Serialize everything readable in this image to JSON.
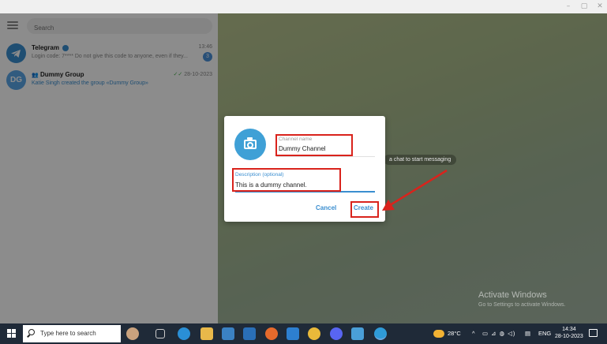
{
  "window": {
    "minimize_glyph": "–",
    "maximize_glyph": "▢",
    "close_glyph": "✕"
  },
  "sidebar": {
    "search_placeholder": "Search",
    "chats": [
      {
        "name": "Telegram",
        "verified": true,
        "time": "13:46",
        "preview": "Login code: 7**** Do not give this code to anyone, even if they...",
        "unread": "3",
        "avatar_color": "#3a8ed0"
      },
      {
        "name": "Dummy Group",
        "avatar_initials": "DG",
        "time": "28-10-2023",
        "preview": "Katie Singh created the group «Dummy Group»",
        "avatar_color": "#5aa6e8",
        "read_icon": "double-check-icon"
      }
    ]
  },
  "chat_area": {
    "hint": "a chat to start messaging"
  },
  "dialog": {
    "name_label": "Channel name",
    "name_value": "Dummy Channel",
    "description_label": "Description (optional)",
    "description_value": "This is a dummy channel.",
    "cancel_label": "Cancel",
    "create_label": "Create",
    "photo_icon": "camera-icon",
    "accent_color": "#3a8ed0"
  },
  "watermark": {
    "title": "Activate Windows",
    "subtitle": "Go to Settings to activate Windows."
  },
  "taskbar": {
    "search_text": "Type here to search",
    "weather": "28°C",
    "language": "ENG",
    "time": "14:34",
    "date": "28-10-2023"
  },
  "annotations": {
    "highlight_color": "#d9231c"
  }
}
